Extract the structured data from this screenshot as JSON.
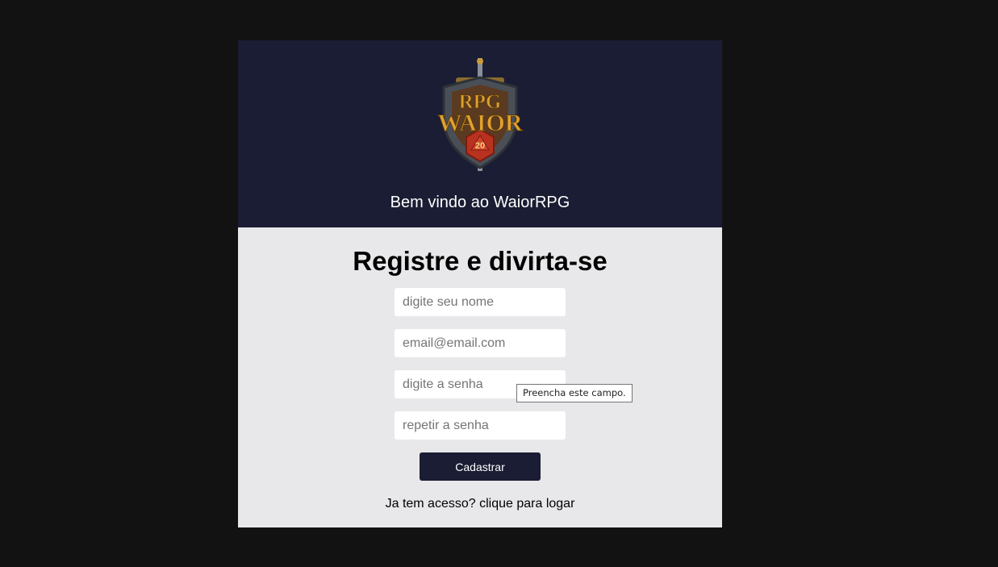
{
  "header": {
    "logo": {
      "icon": "rpg-waior-shield-logo",
      "line1": "RPG",
      "line2": "WAIOR",
      "dice_number": "20"
    },
    "welcome_text": "Bem vindo ao WaiorRPG"
  },
  "form": {
    "title": "Registre e divirta-se",
    "fields": [
      {
        "placeholder": "digite seu nome",
        "value": ""
      },
      {
        "placeholder": "email@email.com",
        "value": ""
      },
      {
        "placeholder": "digite a senha",
        "value": ""
      },
      {
        "placeholder": "repetir a senha",
        "value": ""
      }
    ],
    "submit_label": "Cadastrar",
    "login_link": "Ja tem acesso? clique para logar"
  },
  "validation_tooltip": "Preencha este campo.",
  "colors": {
    "page_background": "#121212",
    "header_background": "#1a1d33",
    "form_background": "#e8e8ea",
    "button_background": "#1a1d33",
    "logo_gold": "#e0a22e",
    "dice_red": "#b8321f"
  }
}
